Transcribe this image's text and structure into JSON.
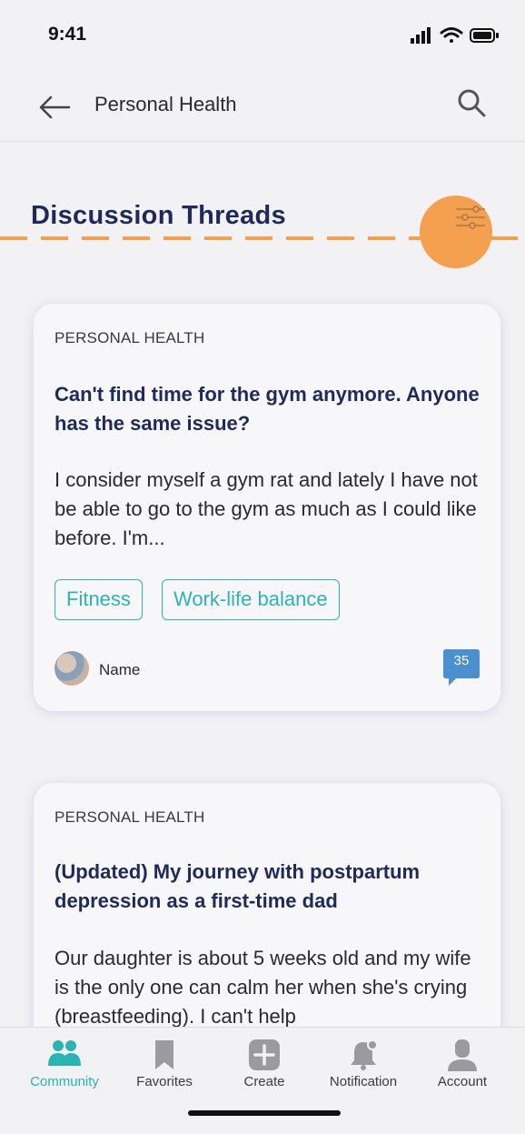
{
  "status_bar": {
    "time": "9:41"
  },
  "header": {
    "title": "Personal Health"
  },
  "section": {
    "title": "Discussion Threads"
  },
  "threads": [
    {
      "category": "PERSONAL HEALTH",
      "title": "Can't find time for the gym anymore. Anyone has the same issue?",
      "excerpt": "I consider myself a gym rat and lately I have not be able to go to the gym as much as I could like before. I'm...",
      "tags": [
        "Fitness",
        "Work-life balance"
      ],
      "author": "Name",
      "comments": "35"
    },
    {
      "category": "PERSONAL HEALTH",
      "title": "(Updated) My journey with postpartum depression as a first-time dad",
      "excerpt": "Our daughter is about 5 weeks old and my wife is the only one can calm her when she's crying (breastfeeding). I can't help"
    }
  ],
  "tabs": [
    {
      "label": "Community",
      "icon": "community-icon",
      "active": true
    },
    {
      "label": "Favorites",
      "icon": "bookmark-icon"
    },
    {
      "label": "Create",
      "icon": "plus-icon"
    },
    {
      "label": "Notification",
      "icon": "bell-icon"
    },
    {
      "label": "Account",
      "icon": "user-icon"
    }
  ],
  "colors": {
    "accent": "#2bb4b4",
    "title": "#1f2a5a",
    "highlight": "#f5a04e",
    "badge": "#4a8fcf"
  }
}
